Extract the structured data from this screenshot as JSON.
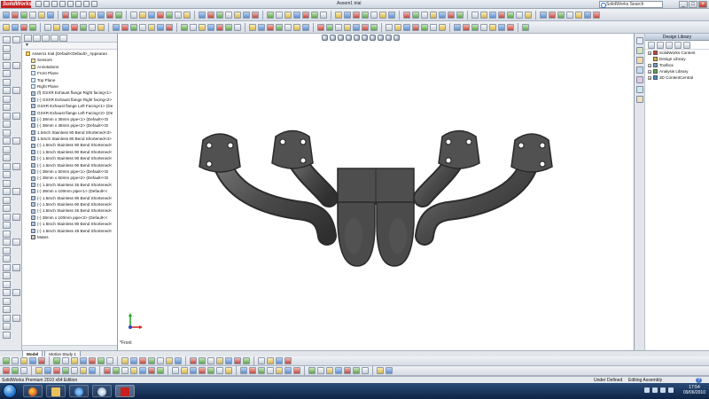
{
  "titlebar": {
    "app_name": "SolidWorks",
    "window_title": "Assem1 trial",
    "search_placeholder": "SolidWorks Search",
    "controls": {
      "minimize": "_",
      "maximize": "□",
      "close": "×"
    }
  },
  "feature_manager": {
    "filter_label": "▼",
    "root": "Assem1 trial  (Default<Default>_Appearan",
    "items": [
      "Sensors",
      "Annotations",
      "Front Plane",
      "Top Plane",
      "Right Plane",
      "(f) GSXR Exhaust flange Right facing<1>",
      "(-) GSXR Exhaust flange Right facing<2>",
      "GSXR Exhaust flange Left Facing<1> (De",
      "GSXR Exhaust flange Left Facing<2> (De",
      "(-) 38mm x 38mm pipe<1> (Default<<D",
      "(-) 38mm x 38mm pipe<2> (Default<<D",
      "1.5Inch Stainless 90 Bend Shortened<3>",
      "1.5Inch Stainless 90 Bend Shortened<4>",
      "(-) 1.5Inch Stainless 90 Bend Shortened<",
      "(-) 1.5Inch Stainless 90 Bend Shortened<",
      "(-) 1.5Inch Stainless 90 Bend Shortened<",
      "(-) 1.5Inch Stainless 90 Bend Shortened<",
      "(-) 38mm x 50mm pipe<1> (Default<<D",
      "(-) 38mm x 50mm pipe<2> (Default<<D",
      "(-) 1.5Inch Stainless 45 Bend Shortened<",
      "(-) 38mm x 100mm pipe<1> (Default<<",
      "(-) 1.5Inch Stainless 90 Bend Shortened<",
      "(-) 1.5Inch Stainless 90 Bend Shortened<",
      "(-) 1.5Inch Stainless 45 Bend Shortened<",
      "(-) 38mm x 100mm pipe<2> (Default<<",
      "(-) 1.5Inch Stainless 90 Bend Shortened<",
      "(-) 1.5Inch Stainless 45 Bend Shortened<",
      "Mates"
    ]
  },
  "graphics": {
    "view_label": "*Front",
    "part_color": "#4a4a4a"
  },
  "task_pane": {
    "title": "Design Library",
    "items": [
      {
        "label": "SolidWorks Content",
        "icon": "solidworks-content-icon",
        "expand": "+"
      },
      {
        "label": "Design Library",
        "icon": "design-library-icon",
        "expand": ""
      },
      {
        "label": "Toolbox",
        "icon": "toolbox-icon",
        "expand": "+"
      },
      {
        "label": "Analysis Library",
        "icon": "analysis-library-icon",
        "expand": "+"
      },
      {
        "label": "3D ContentCentral",
        "icon": "content-central-icon",
        "expand": "+"
      }
    ]
  },
  "model_tabs": [
    "Model",
    "Motion Study 1"
  ],
  "status": {
    "app": "SolidWorks Premium 2010 x64 Edition",
    "definition": "Under Defined",
    "mode": "Editing Assembly",
    "help": "?"
  },
  "taskbar": {
    "time": "17:54",
    "date": "09/06/2010"
  },
  "colors": {
    "accent": "#c81f1f",
    "taskbar": "#1b3560"
  }
}
